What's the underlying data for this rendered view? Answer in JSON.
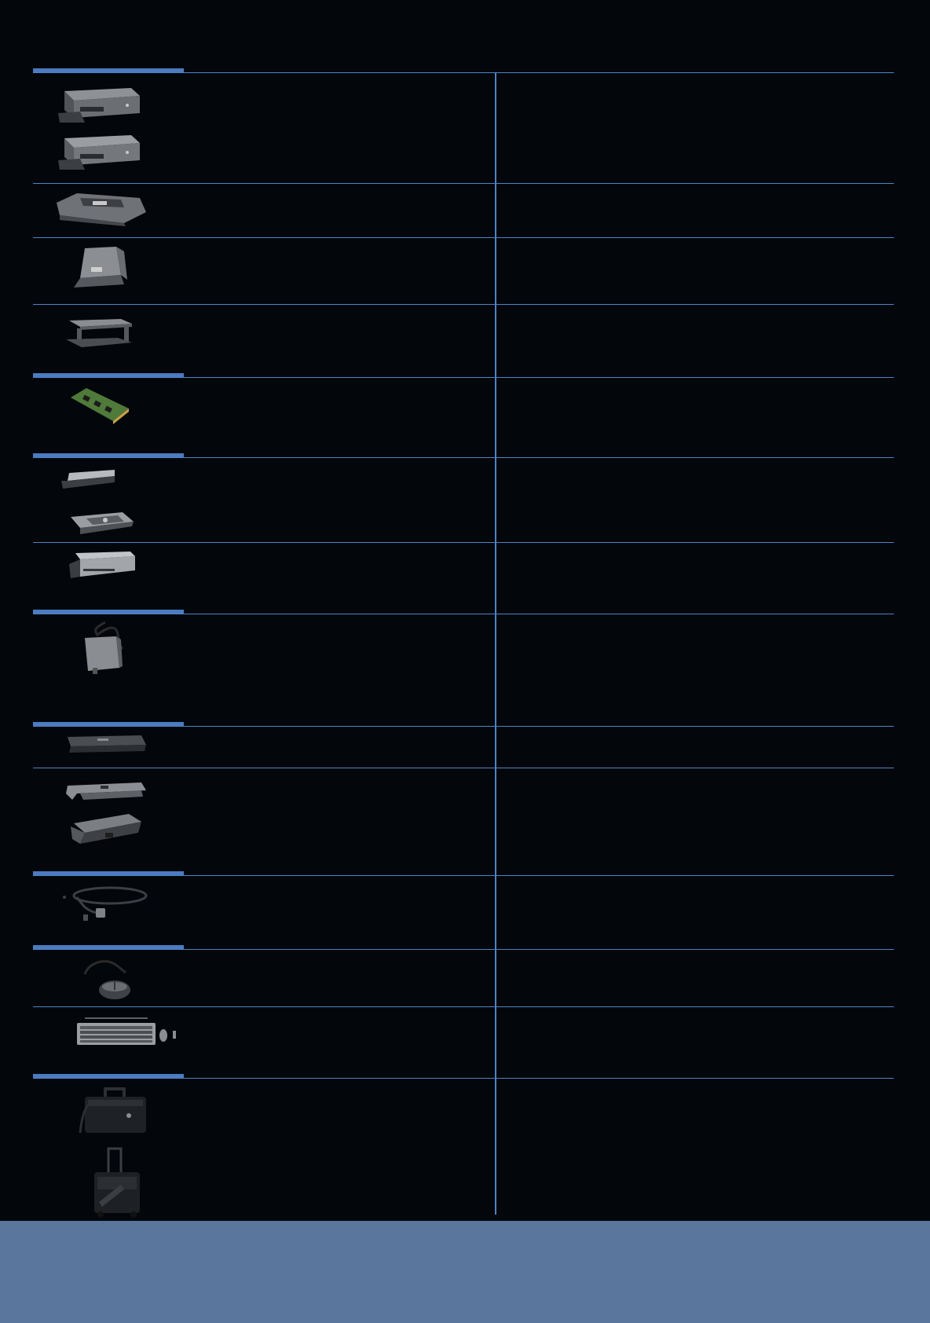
{
  "page": {
    "background": "#03070c",
    "rule_color": "#4f82c4",
    "footer_color": "#5a769c"
  },
  "sections": [
    {
      "name": "docking",
      "products": [
        "docking-station-icon",
        "docking-station-icon",
        "notebook-dock-icon",
        "notebook-stand-icon",
        "monitor-stand-icon"
      ]
    },
    {
      "name": "memory",
      "products": [
        "memory-module-icon"
      ]
    },
    {
      "name": "drives",
      "products": [
        "optical-drive-icon",
        "hard-drive-caddy-icon",
        "external-drive-icon"
      ]
    },
    {
      "name": "power",
      "products": [
        "ac-adapter-icon"
      ]
    },
    {
      "name": "batteries",
      "products": [
        "battery-icon",
        "battery-bar-icon",
        "battery-slice-icon"
      ]
    },
    {
      "name": "security",
      "products": [
        "cable-lock-icon"
      ]
    },
    {
      "name": "input",
      "products": [
        "mouse-icon",
        "keyboard-mouse-icon"
      ]
    },
    {
      "name": "cases",
      "products": [
        "carrying-case-icon",
        "rolling-case-icon"
      ]
    }
  ]
}
